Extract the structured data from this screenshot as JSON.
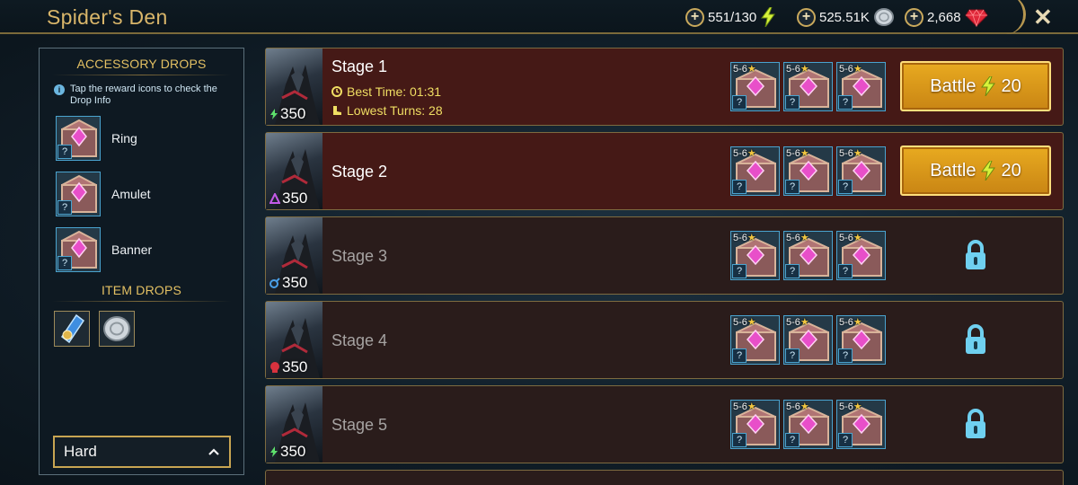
{
  "header": {
    "title": "Spider's Den",
    "resources": [
      {
        "value": "551/130",
        "icon": "energy-bolt-icon"
      },
      {
        "value": "525.51K",
        "icon": "silver-coin-icon"
      },
      {
        "value": "2,668",
        "icon": "gem-icon"
      }
    ],
    "close_symbol": "✕"
  },
  "sidebar": {
    "accessory_heading": "ACCESSORY DROPS",
    "hint": "Tap the reward icons to check the Drop Info",
    "accessories": [
      {
        "label": "Ring"
      },
      {
        "label": "Amulet"
      },
      {
        "label": "Banner"
      }
    ],
    "item_heading": "ITEM DROPS",
    "item_icons": [
      "accessory-shard-icon",
      "silver-coin-icon"
    ],
    "difficulty": "Hard"
  },
  "common": {
    "question": "?",
    "reward_rank": "5-6",
    "energy_cost": "350",
    "battle_label": "Battle",
    "battle_cost": "20"
  },
  "stages": [
    {
      "name": "Stage 1",
      "best_time": "Best Time: 01:31",
      "lowest_turns": "Lowest Turns: 28",
      "affinity": "force",
      "state": "unlocked"
    },
    {
      "name": "Stage 2",
      "affinity": "magic",
      "state": "unlocked"
    },
    {
      "name": "Stage 3",
      "affinity": "spirit",
      "state": "locked"
    },
    {
      "name": "Stage 4",
      "affinity": "void",
      "state": "locked"
    },
    {
      "name": "Stage 5",
      "affinity": "force",
      "state": "locked"
    }
  ],
  "colors": {
    "gold": "#d9b66a",
    "battle_button": "#d89818",
    "active_row": "#451916",
    "locked_row": "#2a1c1b",
    "lock": "#6fd0f0"
  }
}
